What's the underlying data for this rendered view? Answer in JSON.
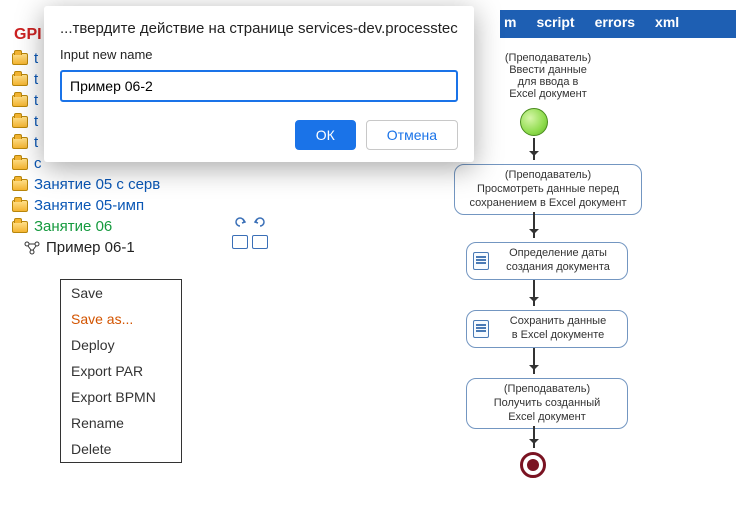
{
  "top_tabs": {
    "partial": "m",
    "script": "script",
    "errors": "errors",
    "xml": "xml"
  },
  "tree": {
    "head_partial": "GPI",
    "rows": [
      {
        "label": "t"
      },
      {
        "label": "t"
      },
      {
        "label": "t"
      },
      {
        "label": "t"
      },
      {
        "label": "t"
      },
      {
        "label": "c"
      },
      {
        "label": "Занятие 05 с серв"
      },
      {
        "label": "Занятие 05-имп"
      },
      {
        "label": "Занятие 06",
        "green": true
      },
      {
        "label": "Пример 06-1",
        "black": true,
        "proc": true
      }
    ]
  },
  "ctx": {
    "save": "Save",
    "saveas": "Save as...",
    "deploy": "Deploy",
    "exportpar": "Export PAR",
    "exportbpmn": "Export BPMN",
    "rename": "Rename",
    "delete": "Delete"
  },
  "modal": {
    "title": "...твердите действие на странице services-dev.processtech.ru",
    "label": "Input new name",
    "value": "Пример 06-2",
    "ok": "ОК",
    "cancel": "Отмена"
  },
  "diagram": {
    "n1_role": "(Преподаватель)",
    "n1_l1": "Ввести данные",
    "n1_l2": "для ввода в",
    "n1_l3": "Excel документ",
    "n2_role": "(Преподаватель)",
    "n2_l1": "Просмотреть данные перед",
    "n2_l2": "сохранением в Excel документ",
    "n3_l1": "Определение даты",
    "n3_l2": "создания документа",
    "n4_l1": "Сохранить данные",
    "n4_l2": "в Excel документе",
    "n5_role": "(Преподаватель)",
    "n5_l1": "Получить созданный",
    "n5_l2": "Excel документ"
  }
}
